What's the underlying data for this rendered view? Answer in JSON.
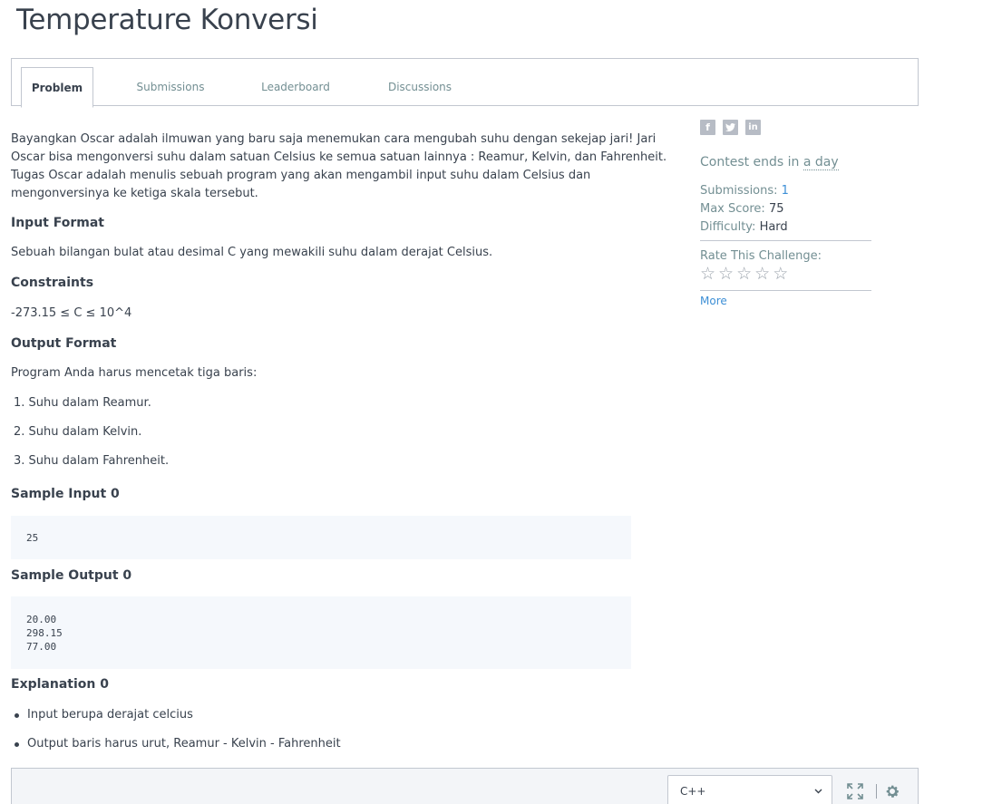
{
  "title": "Temperature Konversi",
  "tabs": [
    {
      "label": "Problem",
      "active": true
    },
    {
      "label": "Submissions"
    },
    {
      "label": "Leaderboard"
    },
    {
      "label": "Discussions"
    }
  ],
  "problem": {
    "intro_lines": [
      "Bayangkan Oscar adalah ilmuwan yang baru saja menemukan cara mengubah suhu dengan sekejap jari! Jari",
      "Oscar bisa mengonversi suhu dalam satuan Celsius ke semua satuan lainnya : Reamur, Kelvin, dan Fahrenheit.",
      "Tugas Oscar adalah menulis sebuah program yang akan mengambil input suhu dalam Celsius dan",
      "mengonversinya ke ketiga skala tersebut."
    ],
    "input_format_heading": "Input Format",
    "input_format_text": "Sebuah bilangan bulat atau desimal C yang mewakili suhu dalam derajat Celsius.",
    "constraints_heading": "Constraints",
    "constraints_text": "-273.15 ≤ C ≤ 10^4",
    "output_format_heading": "Output Format",
    "output_format_text": "Program Anda harus mencetak tiga baris:",
    "output_items": [
      "1. Suhu dalam Reamur.",
      "2. Suhu dalam Kelvin.",
      "3. Suhu dalam Fahrenheit."
    ],
    "sample_input_heading": "Sample Input 0",
    "sample_input": "25",
    "sample_output_heading": "Sample Output 0",
    "sample_output": "20.00\n298.15\n77.00",
    "explanation_heading": "Explanation 0",
    "explanation_items": [
      "Input berupa derajat celcius",
      "Output baris harus urut, Reamur - Kelvin - Fahrenheit"
    ]
  },
  "sidebar": {
    "share_icons": [
      "facebook-icon",
      "twitter-icon",
      "linkedin-icon"
    ],
    "contest_prefix": "Contest ends in",
    "contest_time": "a day",
    "submissions_label": "Submissions:",
    "submissions_value": "1",
    "max_score_label": "Max Score:",
    "max_score_value": "75",
    "difficulty_label": "Difficulty:",
    "difficulty_value": "Hard",
    "rate_label": "Rate This Challenge:",
    "rating": 0,
    "rating_max": 5,
    "more_label": "More"
  },
  "editor": {
    "language": "C++"
  }
}
